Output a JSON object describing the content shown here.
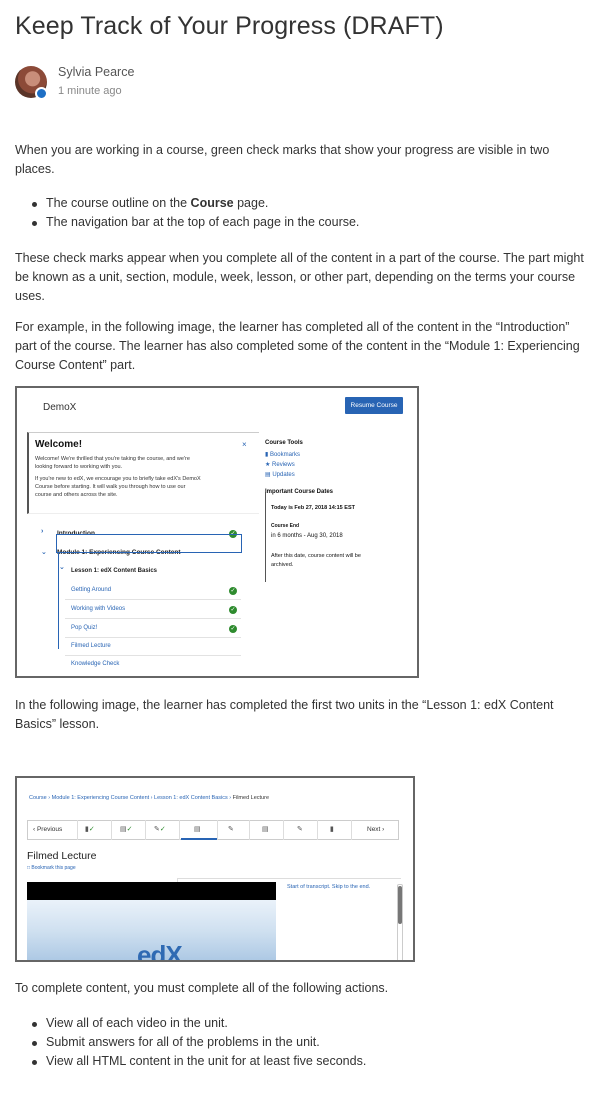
{
  "article": {
    "title": "Keep Track of Your Progress (DRAFT)",
    "author": "Sylvia Pearce",
    "time": "1 minute ago"
  },
  "body": {
    "p1": "When you are working in a course, green check marks that show your progress are visible in two places.",
    "bullets1": [
      {
        "before": "The course outline on the ",
        "bold": "Course",
        "after": " page."
      },
      {
        "text": "The navigation bar at the top of each page in the course."
      }
    ],
    "p2": "These check marks appear when you complete all of the content in a part of the course. The part might be known as a unit, section, module, week, lesson, or other part, depending on the terms your course uses.",
    "p3": "For example, in the following image, the learner has completed all of the content in the “Introduction” part of the course. The learner has also completed some of the content in the “Module 1: Experiencing Course Content” part.",
    "p4": "In the following image, the learner has completed the first two units in the “Lesson 1: edX Content Basics” lesson.",
    "p5": "To complete content, you must complete all of the following actions.",
    "bullets2": [
      "View all of each video in the unit.",
      "Submit answers for all of the problems in the unit.",
      "View all HTML content in the unit for at least five seconds."
    ]
  },
  "screenshot1": {
    "logo": "DemoX",
    "resume": "Resume Course",
    "welcome_title": "Welcome!",
    "close": "×",
    "welcome_line1": "Welcome! We're thrilled that you're taking the course, and we're",
    "welcome_line2": "looking forward to working with you.",
    "welcome_line3": "If you're new to edX, we encourage you to briefly take edX's DemoX",
    "welcome_line4": "Course before starting. It will walk you through how to use our",
    "welcome_line5": "course and others across the site.",
    "outline": {
      "intro": "Introduction",
      "module1": "Module 1: Experiencing Course Content",
      "lesson1": "Lesson 1: edX Content Basics",
      "units": [
        "Getting Around",
        "Working with Videos",
        "Pop Quiz!",
        "Filmed Lecture",
        "Knowledge Check"
      ]
    },
    "side": {
      "tools": "Course Tools",
      "bookmarks": "Bookmarks",
      "reviews": "Reviews",
      "updates": "Updates",
      "dates": "Important Course Dates",
      "today": "Today is Feb 27, 2018 14:15 EST",
      "end_label": "Course End",
      "end_date": "in 6 months - Aug 30, 2018",
      "note1": "After this date, course content will be",
      "note2": "archived."
    }
  },
  "screenshot2": {
    "crumbs": [
      "Course",
      "Module 1: Experiencing Course Content",
      "Lesson 1: edX Content Basics",
      "Filmed Lecture"
    ],
    "prev": "‹ Previous",
    "next": "Next ›",
    "title": "Filmed Lecture",
    "bookmark": "□ Bookmark this page",
    "transcript": "Start of transcript. Skip to the end.",
    "video_logo": "edX"
  }
}
